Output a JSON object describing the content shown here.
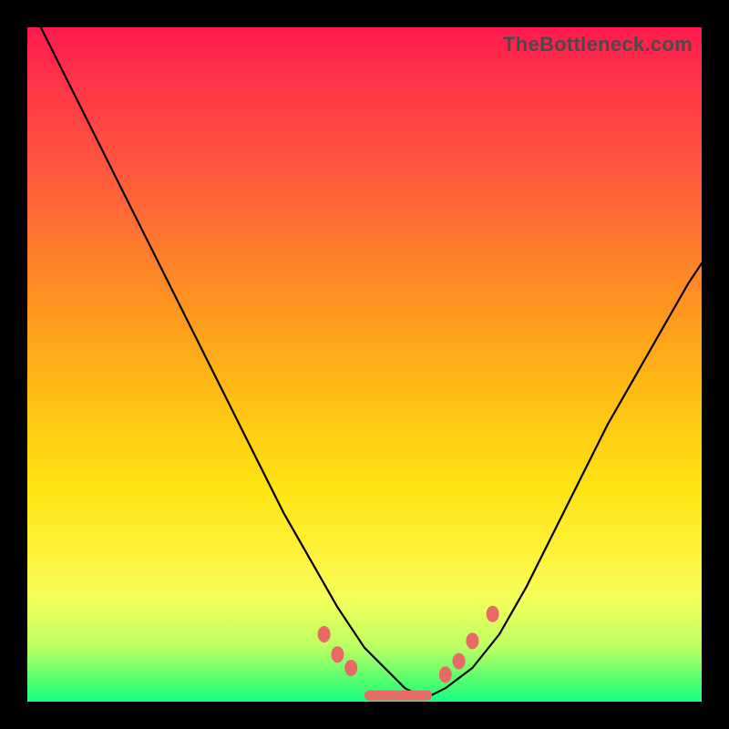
{
  "watermark": "TheBottleneck.com",
  "colors": {
    "background": "#000000",
    "gradient_top": "#ff1a4d",
    "gradient_mid": "#ffe312",
    "gradient_bottom": "#14ff8a",
    "curve": "#000000",
    "markers": "#e86a66"
  },
  "chart_data": {
    "type": "line",
    "title": "",
    "xlabel": "",
    "ylabel": "",
    "xlim": [
      0,
      100
    ],
    "ylim": [
      0,
      100
    ],
    "grid": false,
    "legend": false,
    "series": [
      {
        "name": "bottleneck-curve",
        "x": [
          2,
          6,
          10,
          14,
          18,
          22,
          26,
          30,
          34,
          38,
          42,
          46,
          50,
          54,
          56,
          58,
          60,
          62,
          66,
          70,
          74,
          78,
          82,
          86,
          90,
          94,
          98,
          100
        ],
        "values": [
          100,
          92,
          84,
          76,
          68,
          60,
          52,
          44,
          36,
          28,
          21,
          14,
          8,
          4,
          2,
          1,
          1,
          2,
          5,
          10,
          17,
          25,
          33,
          41,
          48,
          55,
          62,
          65
        ]
      }
    ],
    "markers": [
      {
        "name": "left-cluster-1",
        "x": 44,
        "y": 10
      },
      {
        "name": "left-cluster-2",
        "x": 46,
        "y": 7
      },
      {
        "name": "left-cluster-3",
        "x": 48,
        "y": 5
      },
      {
        "name": "right-cluster-1",
        "x": 62,
        "y": 4
      },
      {
        "name": "right-cluster-2",
        "x": 64,
        "y": 6
      },
      {
        "name": "right-cluster-3",
        "x": 66,
        "y": 9
      },
      {
        "name": "right-outlier",
        "x": 69,
        "y": 13
      }
    ],
    "flat_segment": {
      "x_start": 50,
      "x_end": 60,
      "y": 1
    }
  }
}
